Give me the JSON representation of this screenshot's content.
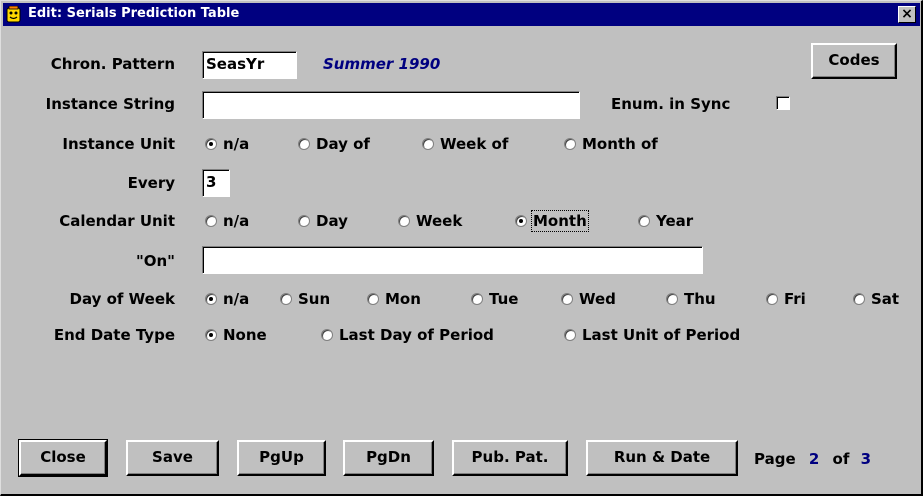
{
  "window": {
    "title": "Edit: Serials Prediction Table",
    "close_glyph": "×"
  },
  "chron_pattern": {
    "label": "Chron. Pattern",
    "value": "SeasYr",
    "example": "Summer 1990"
  },
  "codes_button": "Codes",
  "instance_string": {
    "label": "Instance String",
    "value": ""
  },
  "enum_in_sync": {
    "label": "Enum. in Sync",
    "checked": false
  },
  "instance_unit": {
    "label": "Instance Unit",
    "options": [
      "n/a",
      "Day of",
      "Week of",
      "Month of"
    ],
    "selected": "n/a"
  },
  "every": {
    "label": "Every",
    "value": "3"
  },
  "calendar_unit": {
    "label": "Calendar Unit",
    "options": [
      "n/a",
      "Day",
      "Week",
      "Month",
      "Year"
    ],
    "selected": "Month"
  },
  "on": {
    "label": "\"On\"",
    "value": ""
  },
  "day_of_week": {
    "label": "Day of Week",
    "options": [
      "n/a",
      "Sun",
      "Mon",
      "Tue",
      "Wed",
      "Thu",
      "Fri",
      "Sat"
    ],
    "selected": "n/a"
  },
  "end_date_type": {
    "label": "End Date Type",
    "options": [
      "None",
      "Last Day of Period",
      "Last Unit of Period"
    ],
    "selected": "None"
  },
  "buttons": {
    "close": "Close",
    "save": "Save",
    "pgup": "PgUp",
    "pgdn": "PgDn",
    "pub_pat": "Pub. Pat.",
    "run_date": "Run & Date"
  },
  "pager": {
    "page_label": "Page",
    "current": "2",
    "of_label": "of",
    "total": "3"
  },
  "colors": {
    "titlebar": "#000080",
    "face": "#c0c0c0",
    "accent_text": "#000080"
  }
}
